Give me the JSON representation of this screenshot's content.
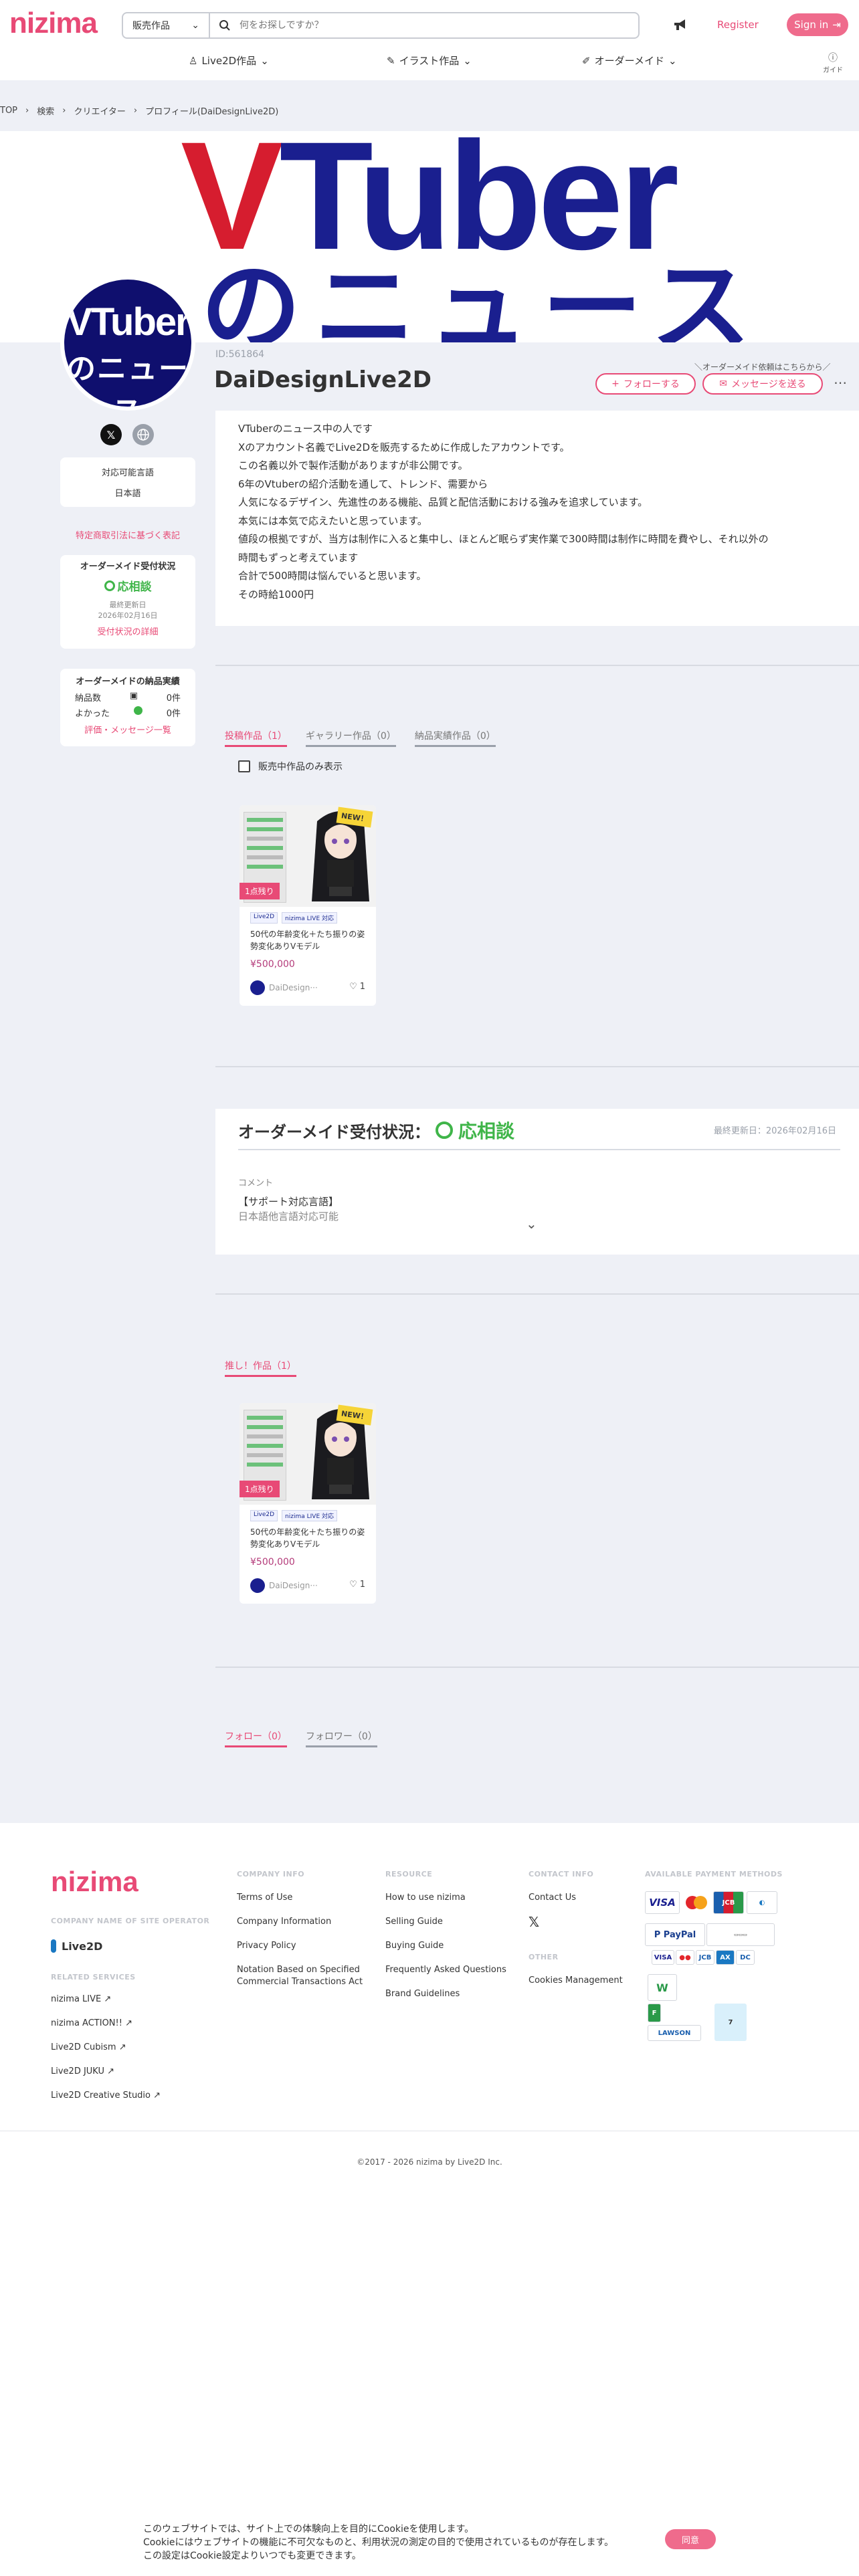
{
  "header": {
    "logo": "nizima",
    "search_category": "販売作品",
    "search_placeholder": "何をお探しですか？",
    "register": "Register",
    "signin": "Sign in",
    "nav": [
      "Live2D作品",
      "イラスト作品",
      "オーダーメイド"
    ],
    "guide": "ガイド"
  },
  "breadcrumb": [
    "TOP",
    "検索",
    "クリエイター",
    "プロフィール(DaiDesignLive2D)"
  ],
  "banner": {
    "v": "V",
    "tuber": "Tuber",
    "sub": "のニュース"
  },
  "avatar": {
    "line1": "VTuber",
    "line2": "のニュース"
  },
  "sidebar": {
    "lang_label": "対応可能言語",
    "lang_value": "日本語",
    "law_link": "特定商取引法に基づく表記",
    "order_title": "オーダーメイド受付状況",
    "order_status": "応相談",
    "updated_label": "最終更新日",
    "updated_date": "2026年02月16日",
    "order_detail_link": "受付状況の詳細",
    "record_title": "オーダーメイドの納品実績",
    "delivered_label": "納品数",
    "delivered_value": "0件",
    "good_label": "よかった",
    "good_value": "0件",
    "review_link": "評価・メッセージ一覧"
  },
  "profile": {
    "id": "ID:561864",
    "name": "DaiDesignLive2D",
    "order_hint": "オーダーメイド依頼はこちらから",
    "follow_btn": "フォローする",
    "message_btn": "メッセージを送る",
    "bio": [
      "VTuberのニュース中の人です",
      "Xのアカウント名義でLive2Dを販売するために作成したアカウントです。",
      "この名義以外で製作活動がありますが非公開です。",
      "6年のVtuberの紹介活動を通して、トレンド、需要から",
      "人気になるデザイン、先進性のある機能、品質と配信活動における強みを追求しています。",
      "本気には本気で応えたいと思っています。",
      "値段の根拠ですが、当方は制作に入ると集中し、ほとんど眠らず実作業で300時間は制作に時間を費やし、それ以外の",
      "時間もずっと考えています",
      "合計で500時間は悩んでいると思います。",
      "その時給1000円"
    ]
  },
  "works_tabs": [
    "投稿作品（1）",
    "ギャラリー作品（0）",
    "納品実績作品（0）"
  ],
  "works_filter": "販売中作品のみ表示",
  "product": {
    "new": "NEW！",
    "remaining": "1点残り",
    "tag1": "Live2D",
    "tag2": "nizima LIVE 対応",
    "title": "50代の年齢変化＋たち振りの姿勢変化ありVモデル",
    "price": "¥500,000",
    "author": "DaiDesign···",
    "likes": "1"
  },
  "order": {
    "title": "オーダーメイド受付状況：",
    "status": "応相談",
    "updated": "最終更新日：2026年02月16日",
    "comment_label": "コメント",
    "comment_line1": "【サポート対応言語】",
    "comment_line2": "日本語他言語対応可能"
  },
  "recommend_tab": "推し！作品（1）",
  "follow_tabs": [
    "フォロー（0）",
    "フォロワー（0）"
  ],
  "footer": {
    "logo": "nizima",
    "operator_head": "COMPANY NAME OF SITE OPERATOR",
    "operator_logo": "Live2D",
    "services_head": "RELATED SERVICES",
    "services": [
      "nizima LIVE",
      "nizima ACTION!!",
      "Live2D Cubism",
      "Live2D JUKU",
      "Live2D Creative Studio"
    ],
    "company_head": "COMPANY INFO",
    "company": [
      "Terms of Use",
      "Company Information",
      "Privacy Policy",
      "Notation Based on Specified",
      "Commercial Transactions Act"
    ],
    "resource_head": "RESOURCE",
    "resource": [
      "How to use nizima",
      "Selling Guide",
      "Buying Guide",
      "Frequently Asked Questions",
      "Brand Guidelines"
    ],
    "contact_head": "CONTACT INFO",
    "contact": "Contact Us",
    "other_head": "OTHER",
    "other": "Cookies Management",
    "payment_head": "AVAILABLE PAYMENT METHODS",
    "copyright": "©2017 - 2026 nizima by Live2D Inc."
  },
  "cookie": {
    "line1": "このウェブサイトでは、サイト上での体験向上を目的にCookieを使用します。",
    "line2": "Cookieにはウェブサイトの機能に不可欠なものと、利用状況の測定の目的で使用されているものが存在します。",
    "line3": "この設定はCookie設定よりいつでも変更できます。",
    "agree": "同意"
  },
  "colors": {
    "accent": "#e84a76",
    "status_green": "#3fb549",
    "page_bg": "#eef0f6"
  }
}
